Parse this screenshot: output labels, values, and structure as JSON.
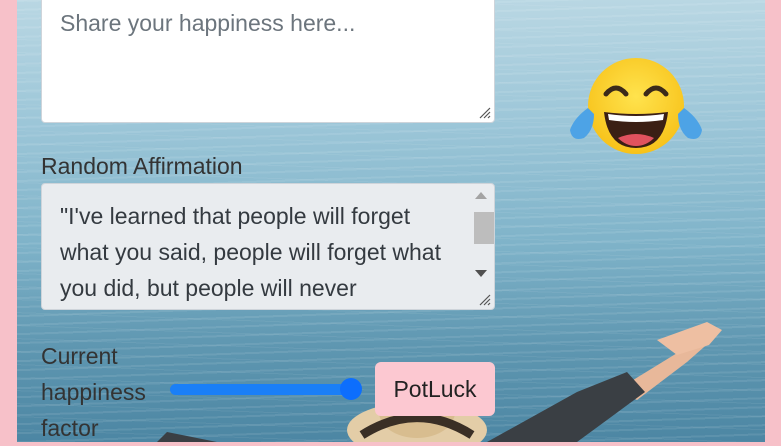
{
  "happiness_input": {
    "placeholder": "Share your happiness here..."
  },
  "affirmation": {
    "label": "Random Affirmation",
    "text": "\"I've learned that people will forget what you said, people will forget what you did, but people will never"
  },
  "happiness_factor": {
    "label": "Current happiness factor",
    "value_fraction": 1.0
  },
  "potluck_button": {
    "label": "PotLuck"
  },
  "emoji": {
    "icon": "face-with-tears-of-joy-icon"
  },
  "colors": {
    "page_background": "#f7c1c9",
    "button_background": "#fcc8d1",
    "slider_accent": "#0d6efd"
  }
}
